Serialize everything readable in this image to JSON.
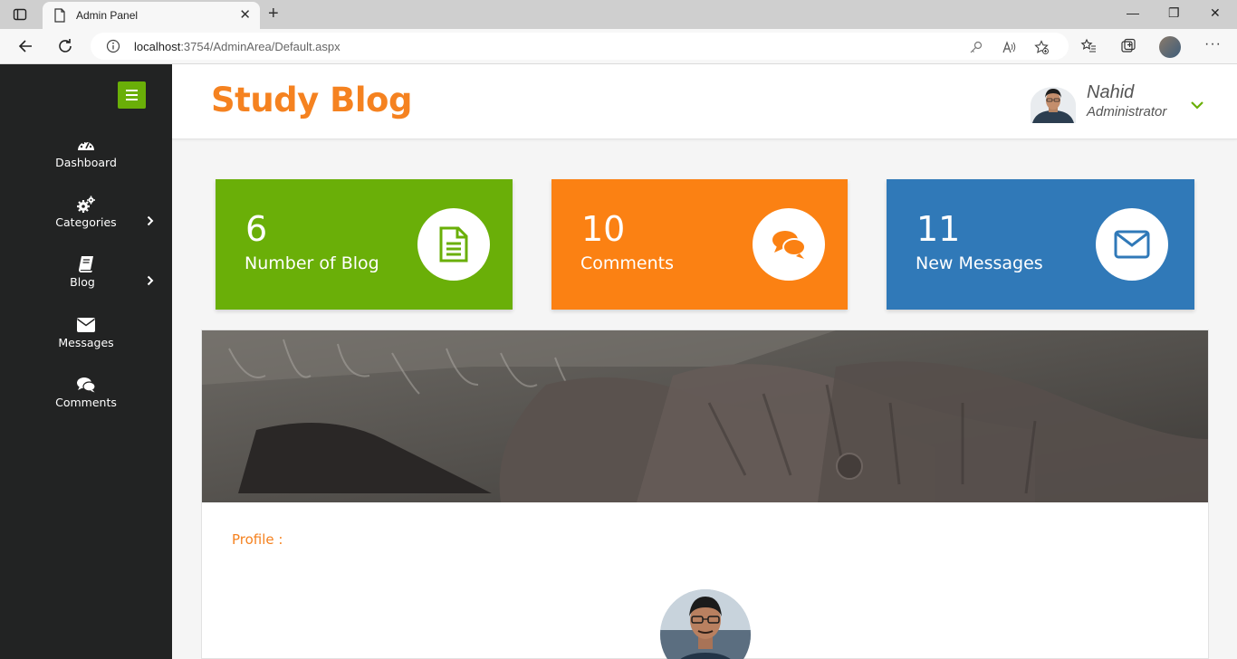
{
  "browser": {
    "tab_title": "Admin Panel",
    "close_glyph": "✕",
    "newtab_glyph": "+",
    "url_host": "localhost",
    "url_path": ":3754/AdminArea/Default.aspx",
    "more_glyph": "···",
    "minimize_glyph": "—",
    "restore_glyph": "❐",
    "close_window_glyph": "✕"
  },
  "sidebar": {
    "items": [
      {
        "label": "Dashboard",
        "icon": "dashboard-icon"
      },
      {
        "label": "Categories",
        "icon": "gears-icon"
      },
      {
        "label": "Blog",
        "icon": "book-icon"
      },
      {
        "label": "Messages",
        "icon": "envelope-icon"
      },
      {
        "label": "Comments",
        "icon": "comments-icon"
      }
    ]
  },
  "header": {
    "brand": "Study Blog",
    "user_name": "Nahid",
    "user_role": "Administrator"
  },
  "stats": [
    {
      "value": "6",
      "label": "Number of Blog",
      "color": "#6aaf08",
      "icon": "document-icon"
    },
    {
      "value": "10",
      "label": "Comments",
      "color": "#fb8113",
      "icon": "comments-icon"
    },
    {
      "value": "11",
      "label": "New Messages",
      "color": "#3079b8",
      "icon": "envelope-icon"
    }
  ],
  "panel": {
    "profile_label": "Profile :"
  },
  "colors": {
    "accent_orange": "#f58220",
    "accent_green": "#6aaf08",
    "sidebar_bg": "#222323"
  }
}
